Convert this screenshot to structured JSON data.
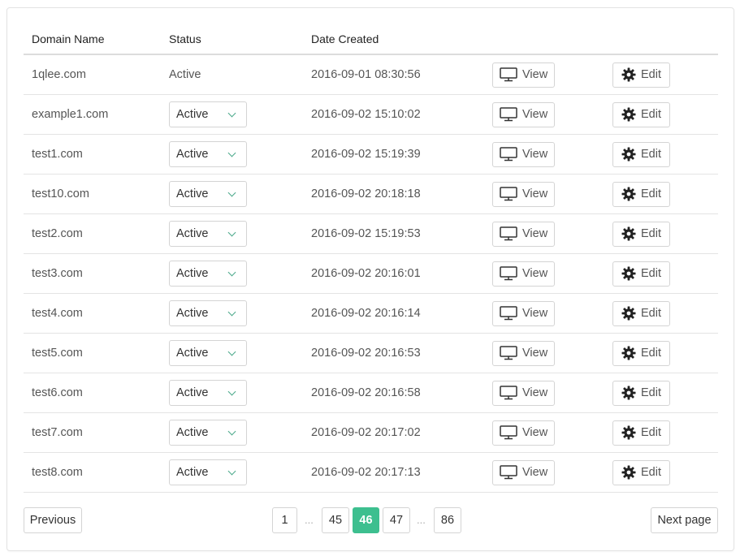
{
  "table": {
    "headers": {
      "domain": "Domain Name",
      "status": "Status",
      "date": "Date Created"
    },
    "view_label": "View",
    "edit_label": "Edit",
    "rows": [
      {
        "domain": "1qlee.com",
        "status": "Active",
        "status_type": "text",
        "date": "2016-09-01 08:30:56"
      },
      {
        "domain": "example1.com",
        "status": "Active",
        "status_type": "select",
        "date": "2016-09-02 15:10:02"
      },
      {
        "domain": "test1.com",
        "status": "Active",
        "status_type": "select",
        "date": "2016-09-02 15:19:39"
      },
      {
        "domain": "test10.com",
        "status": "Active",
        "status_type": "select",
        "date": "2016-09-02 20:18:18"
      },
      {
        "domain": "test2.com",
        "status": "Active",
        "status_type": "select",
        "date": "2016-09-02 15:19:53"
      },
      {
        "domain": "test3.com",
        "status": "Active",
        "status_type": "select",
        "date": "2016-09-02 20:16:01"
      },
      {
        "domain": "test4.com",
        "status": "Active",
        "status_type": "select",
        "date": "2016-09-02 20:16:14"
      },
      {
        "domain": "test5.com",
        "status": "Active",
        "status_type": "select",
        "date": "2016-09-02 20:16:53"
      },
      {
        "domain": "test6.com",
        "status": "Active",
        "status_type": "select",
        "date": "2016-09-02 20:16:58"
      },
      {
        "domain": "test7.com",
        "status": "Active",
        "status_type": "select",
        "date": "2016-09-02 20:17:02"
      },
      {
        "domain": "test8.com",
        "status": "Active",
        "status_type": "select",
        "date": "2016-09-02 20:17:13"
      }
    ]
  },
  "pagination": {
    "previous_label": "Previous",
    "next_label": "Next page",
    "pages": [
      "1",
      "45",
      "46",
      "47",
      "86"
    ],
    "current_page": "46",
    "ellipsis": "..."
  },
  "colors": {
    "accent": "#3dbf8f",
    "border": "#d4d4d4"
  },
  "icons": {
    "view": "monitor-icon",
    "edit": "gear-icon",
    "status": "chevron-down-icon"
  }
}
